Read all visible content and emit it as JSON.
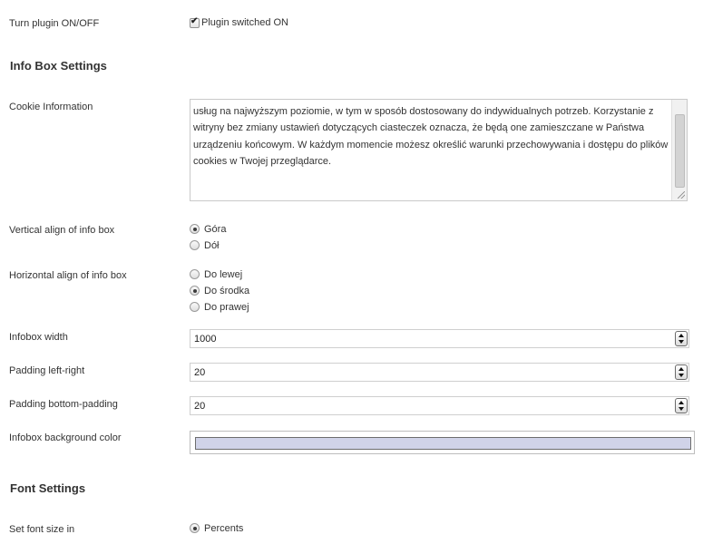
{
  "plugin": {
    "label": "Turn plugin ON/OFF",
    "checkbox_label": "Plugin switched ON",
    "checked": true
  },
  "info_box": {
    "heading": "Info Box Settings",
    "cookie_label": "Cookie Information",
    "cookie_lines": [
      "usług na najwyższym poziomie, w tym w sposób dostosowany do indywidualnych potrzeb. Korzystanie z",
      "witryny bez zmiany ustawień dotyczących ciasteczek oznacza, że będą one zamieszczane w Państwa",
      "urządzeniu końcowym. W każdym momencie możesz określić warunki przechowywania i dostępu do plików",
      "cookies w Twojej przeglądarce."
    ],
    "vertical_label": "Vertical align of info box",
    "vertical_options": [
      "Góra",
      "Dół"
    ],
    "vertical_selected": "Góra",
    "horizontal_label": "Horizontal align of info box",
    "horizontal_options": [
      "Do lewej",
      "Do środka",
      "Do prawej"
    ],
    "horizontal_selected": "Do środka",
    "width_label": "Infobox width",
    "width_value": "1000",
    "padding_lr_label": "Padding left-right",
    "padding_lr_value": "20",
    "padding_tb_label": "Padding bottom-padding",
    "padding_tb_value": "20",
    "bg_color_label": "Infobox background color",
    "bg_color": "#d0d3e8"
  },
  "font": {
    "heading": "Font Settings",
    "size_label": "Set font size in",
    "size_option": "Percents",
    "size_selected": true
  }
}
